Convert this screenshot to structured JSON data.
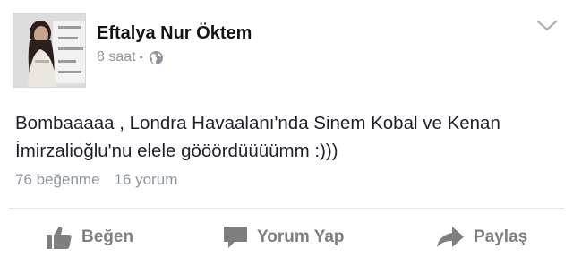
{
  "post": {
    "author_name": "Eftalya Nur Öktem",
    "timestamp": "8 saat",
    "separator": "•",
    "privacy_icon": "globe-icon",
    "menu_icon": "chevron-down-icon",
    "text": "Bombaaaaa , Londra Havaalanı'nda Sinem Kobal ve Kenan İmirzalioğlu'nu elele gööördüüüümm :)))",
    "likes": "76 beğenme",
    "comments": "16 yorum"
  },
  "actions": {
    "like_label": "Beğen",
    "like_icon": "thumbs-up-icon",
    "comment_label": "Yorum Yap",
    "comment_icon": "speech-bubble-icon",
    "share_label": "Paylaş",
    "share_icon": "share-arrow-icon"
  },
  "colors": {
    "meta": "#8d949e",
    "action": "#7f7f7f",
    "text": "#1d2129"
  }
}
